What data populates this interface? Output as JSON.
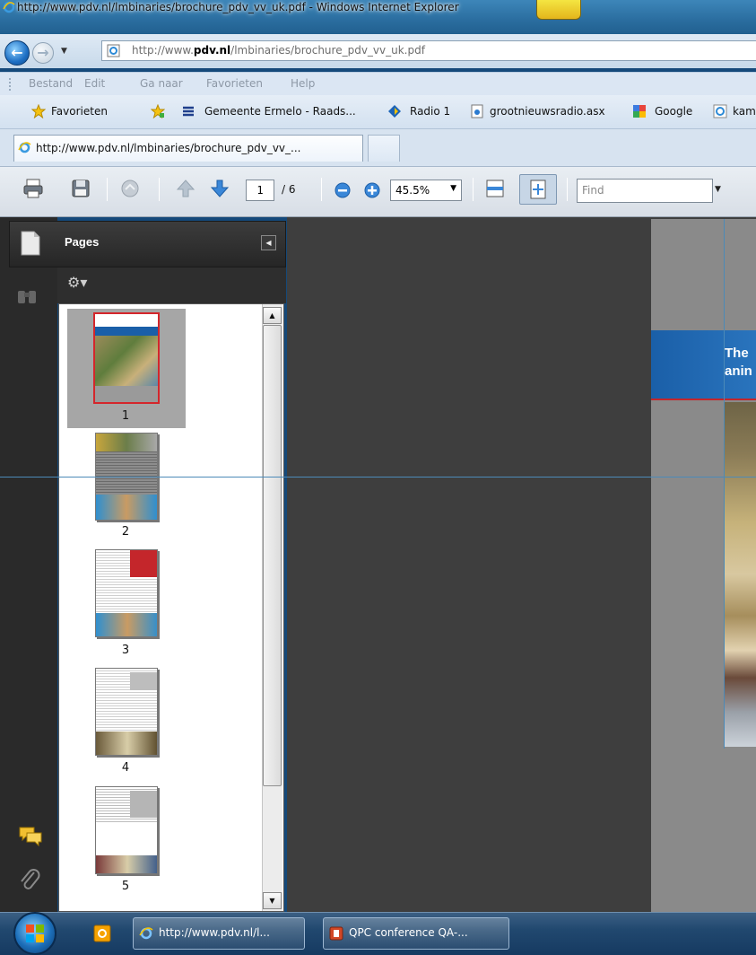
{
  "window": {
    "title": "http://www.pdv.nl/lmbinaries/brochure_pdv_vv_uk.pdf - Windows Internet Explorer"
  },
  "address": {
    "prefix": "http://www.",
    "domain": "pdv.nl",
    "path": "/lmbinaries/brochure_pdv_vv_uk.pdf"
  },
  "menu": [
    "Bestand",
    "Edit",
    "Ga naar",
    "Favorieten",
    "Help"
  ],
  "favorites": {
    "label": "Favorieten",
    "items": [
      "Gemeente Ermelo - Raads...",
      "Radio 1",
      "grootnieuwsradio.asx",
      "Google",
      "kam"
    ]
  },
  "tab": {
    "title": "http://www.pdv.nl/lmbinaries/brochure_pdv_vv_..."
  },
  "reader": {
    "page_current": "1",
    "page_total": "/ 6",
    "zoom": "45.5%",
    "find_placeholder": "Find"
  },
  "pages_panel": {
    "title": "Pages",
    "thumbnails": [
      "1",
      "2",
      "3",
      "4",
      "5"
    ]
  },
  "document": {
    "heading_line1": "The",
    "heading_line2": "anin"
  },
  "taskbar": {
    "items": [
      "http://www.pdv.nl/l...",
      "QPC conference QA-..."
    ]
  },
  "colors": {
    "accent_blue": "#1d6fc4",
    "doc_banner": "#1a5fa8",
    "selection_red": "#d4262b"
  }
}
